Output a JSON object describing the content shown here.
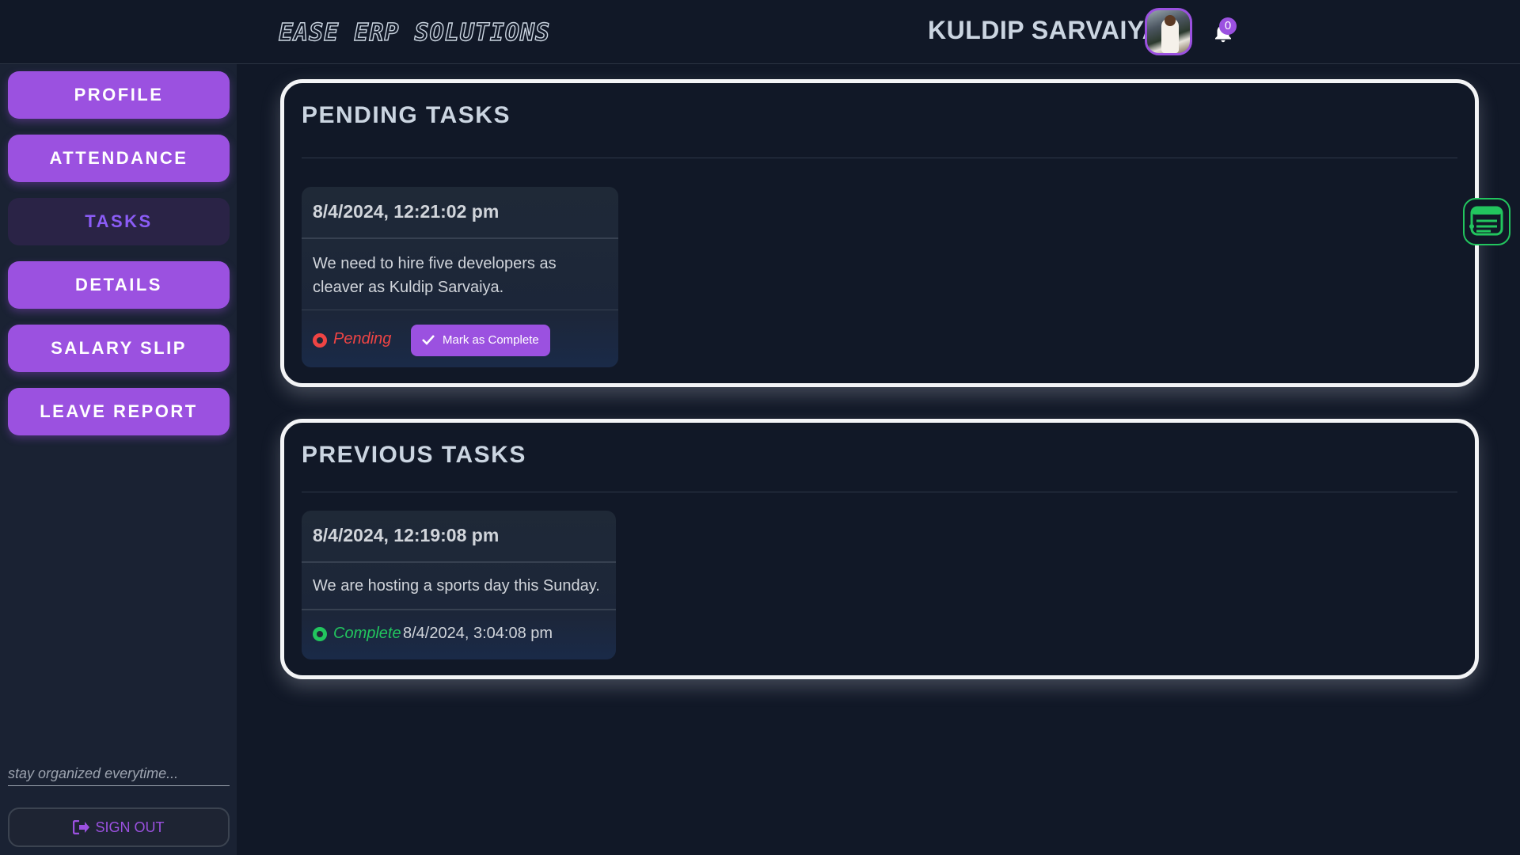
{
  "header": {
    "logo": "EASE ERP SOLUTIONS",
    "user_name": "KULDIP SARVAIYA",
    "notification_count": "0"
  },
  "sidebar": {
    "items": [
      {
        "label": "PROFILE",
        "active": false
      },
      {
        "label": "ATTENDANCE",
        "active": false
      },
      {
        "label": "TASKS",
        "active": true
      },
      {
        "label": "DETAILS",
        "active": false
      },
      {
        "label": "SALARY SLIP",
        "active": false
      },
      {
        "label": "LEAVE REPORT",
        "active": false
      }
    ],
    "tagline": "stay organized everytime...",
    "signout_label": "SIGN OUT"
  },
  "pending": {
    "title": "PENDING TASKS",
    "tasks": [
      {
        "date": "8/4/2024, 12:21:02 pm",
        "description_line1": "We need to hire five developers as",
        "description_line2": "cleaver as Kuldip Sarvaiya.",
        "status": "Pending",
        "action_label": "Mark as Complete"
      }
    ]
  },
  "previous": {
    "title": "PREVIOUS TASKS",
    "tasks": [
      {
        "date": "8/4/2024, 12:19:08 pm",
        "description": "We are hosting a sports day this Sunday.",
        "status": "Complete",
        "completed_at": "8/4/2024, 3:04:08 pm"
      }
    ]
  },
  "colors": {
    "accent": "#9b51e0",
    "background": "#111827",
    "sidebar": "#1a2233",
    "pending": "#ef4444",
    "complete": "#22c55e"
  }
}
